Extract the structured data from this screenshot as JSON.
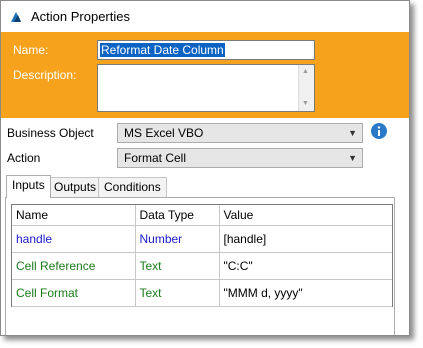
{
  "window": {
    "title": "Action Properties"
  },
  "form": {
    "name_label": "Name:",
    "name_value": "Reformat Date Column",
    "description_label": "Description:",
    "description_value": ""
  },
  "fields": {
    "business_object_label": "Business Object",
    "business_object_value": "MS Excel VBO",
    "action_label": "Action",
    "action_value": "Format Cell"
  },
  "tabs": [
    {
      "label": "Inputs",
      "active": true
    },
    {
      "label": "Outputs",
      "active": false
    },
    {
      "label": "Conditions",
      "active": false
    }
  ],
  "table": {
    "headers": [
      "Name",
      "Data Type",
      "Value"
    ],
    "rows": [
      {
        "name": "handle",
        "type": "Number",
        "value": "[handle]",
        "color": "#1a1acc"
      },
      {
        "name": "Cell Reference",
        "type": "Text",
        "value": "\"C:C\"",
        "color": "#1a7a1a"
      },
      {
        "name": "Cell Format",
        "type": "Text",
        "value": "\"MMM d, yyyy\"",
        "color": "#1a7a1a"
      }
    ]
  },
  "colors": {
    "header_band": "#f7a21c",
    "info_icon": "#2a78c8"
  },
  "icons": [
    "app-icon",
    "info-icon",
    "chevron-down-icon",
    "scroll-up-icon",
    "scroll-down-icon"
  ]
}
